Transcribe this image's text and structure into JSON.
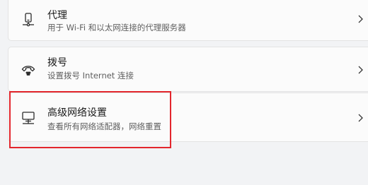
{
  "settings": {
    "items": [
      {
        "title": "代理",
        "description": "用于 Wi-Fi 和以太网连接的代理服务器",
        "icon": "proxy-icon"
      },
      {
        "title": "拨号",
        "description": "设置拨号 Internet 连接",
        "icon": "dialup-icon"
      },
      {
        "title": "高级网络设置",
        "description": "查看所有网络适配器，网络重置",
        "icon": "network-adapter-icon"
      }
    ],
    "chevron_icon": "chevron-right-icon"
  },
  "colors": {
    "background": "#f2f3f5",
    "card": "#fbfbfb",
    "card_border": "#e3e3e3",
    "title_text": "#1a1a1a",
    "description_text": "#5f5f5f",
    "highlight": "#e3262d"
  }
}
